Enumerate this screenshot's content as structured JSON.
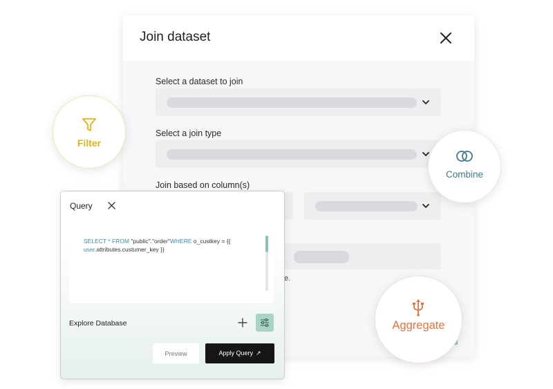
{
  "modal": {
    "title": "Join dataset",
    "fields": [
      {
        "label": "Select a dataset to join"
      },
      {
        "label": "Select a join type"
      },
      {
        "label": "Join based on column(s)"
      }
    ],
    "hint_fragment": "e."
  },
  "bubbles": {
    "filter": {
      "label": "Filter",
      "icon": "funnel-icon",
      "color": "#e0b21a"
    },
    "combine": {
      "label": "Combine",
      "icon": "overlapping-circles-icon",
      "color": "#3f7a88"
    },
    "aggregate": {
      "label": "Aggregate",
      "icon": "trident-icon",
      "color": "#e0743f"
    }
  },
  "query": {
    "title": "Query",
    "sql": {
      "select_kw": "SELECT",
      "star_from": "* FROM",
      "table": "\"public\".\"order\"",
      "where_kw": "WHERE",
      "condition": "o_custkey = {{",
      "user_var": "user",
      "attr_path": ".attributes.custumer_key }}"
    },
    "explore_label": "Explore Database",
    "preview_label": "Preview",
    "apply_label": "Apply Query",
    "apply_arrow": "↗",
    "accent": "#8fc2b0"
  }
}
